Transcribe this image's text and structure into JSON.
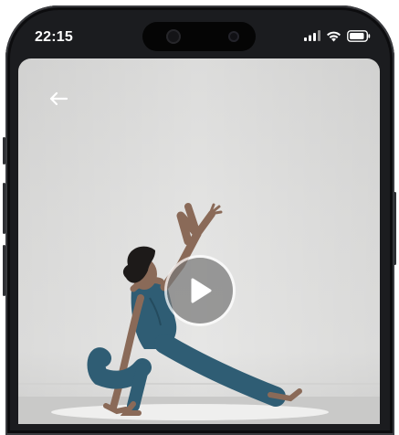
{
  "status_bar": {
    "time": "22:15",
    "icons": [
      "signal-icon",
      "wifi-icon",
      "battery-icon"
    ]
  },
  "player": {
    "back_icon": "back-arrow-icon",
    "play_icon": "play-icon",
    "media": "yoga-pose-photo"
  },
  "colors": {
    "frame": "#1b1c1f",
    "background_wall": "#e3e3e2",
    "outfit": "#2f5d74",
    "play_overlay": "#7a7a7a"
  }
}
